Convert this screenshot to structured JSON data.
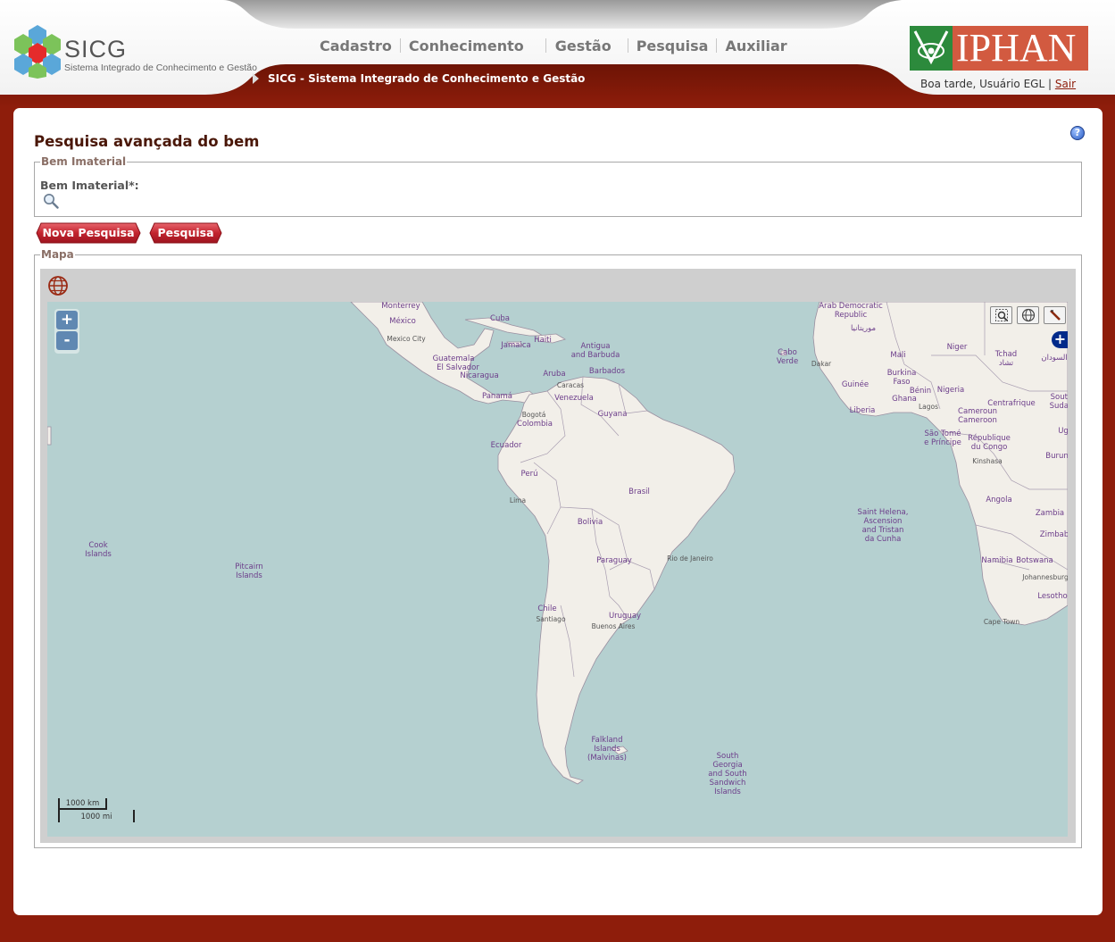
{
  "header": {
    "logo_name": "SICG",
    "logo_subtitle": "Sistema Integrado de Conhecimento e Gestão",
    "nav": [
      "Cadastro",
      "Conhecimento",
      "Gestão",
      "Pesquisa",
      "Auxiliar"
    ],
    "breadcrumb": "SICG - Sistema Integrado de Conhecimento e Gestão",
    "partner_logo": "IPHAN",
    "greeting": "Boa tarde, Usuário EGL",
    "separator": "|",
    "logout": "Sair"
  },
  "page": {
    "title": "Pesquisa avançada do bem",
    "help_icon": "?",
    "fieldset_bem": {
      "legend": "Bem Imaterial",
      "label": "Bem Imaterial",
      "required_marker": "*:"
    },
    "buttons": {
      "new_search": "Nova Pesquisa",
      "search": "Pesquisa"
    },
    "fieldset_map": {
      "legend": "Mapa",
      "zoom_in": "+",
      "zoom_out": "-",
      "layer_switcher": "+",
      "scale_km": "1000 km",
      "scale_mi": "1000 mi"
    }
  },
  "map_labels": {
    "countries": [
      "Monterrey",
      "México",
      "Mexico City",
      "Cuba",
      "Haiti",
      "Jamaica",
      "Antigua\nand Barbuda",
      "Barbados",
      "Guatemala",
      "El Salvador",
      "Nicaragua",
      "Aruba",
      "Caracas",
      "Panamá",
      "Venezuela",
      "Bogotá",
      "Colombia",
      "Guyana",
      "Ecuador",
      "Perú",
      "Brasil",
      "Lima",
      "Bolivia",
      "Paraguay",
      "Rio de Janeiro",
      "Chile",
      "Santiago",
      "Uruguay",
      "Buenos Aires",
      "Falkland\nIslands\n(Malvinas)",
      "South\nGeorgia\nand South\nSandwich\nIslands",
      "Cook\nIslands",
      "Pitcairn\nIslands",
      "Cabo\nVerde",
      "Dakar",
      "Arab Democratic\nRepublic",
      "موريتانيا",
      "Mali",
      "Niger",
      "Tchad\nتشاد",
      "Burkina\nFaso",
      "Guinée",
      "Bénin",
      "Nigeria",
      "Ghana",
      "Lagos",
      "Liberia",
      "Centrafrique",
      "Cameroun\nCameroon",
      "São Tomé\ne Príncipe",
      "République\ndu Congo",
      "Kinshasa",
      "Saint Helena,\nAscension\nand Tristan\nda Cunha",
      "Angola",
      "Zambia",
      "Namibia",
      "Botswana",
      "Johannesburg",
      "Lesotho",
      "Cape Town",
      "South\nSudan",
      "Ug",
      "Burun",
      "Zimbab",
      "السودان"
    ]
  }
}
